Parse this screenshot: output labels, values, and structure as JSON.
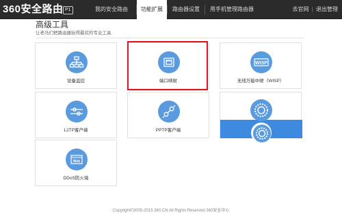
{
  "header": {
    "logo_text": "360安全路由",
    "model_badge": "P1",
    "tabs": [
      {
        "label": "我的安全路由"
      },
      {
        "label": "功能扩展"
      },
      {
        "label": "路由器设置"
      },
      {
        "label": "用手机管理路由器"
      }
    ],
    "right_links": [
      "去官网",
      "退出管理"
    ],
    "divider": "|"
  },
  "main": {
    "title": "高级工具",
    "subtitle": "让老马们把路由器玩得最欢的专业工具"
  },
  "tools": [
    {
      "label": "设备监控",
      "icon": "network-icon"
    },
    {
      "label": "端口映射",
      "icon": "port-icon"
    },
    {
      "label": "无线万能中继（WISP）",
      "icon": "wisp-icon"
    },
    {
      "label": "L2TP客户端",
      "icon": "l2tp-icon"
    },
    {
      "label": "PPTP客户端",
      "icon": "pptp-icon"
    },
    {
      "label": "",
      "icon": "gear-icon"
    },
    {
      "label": "DDoS防火墙",
      "icon": "firewall-icon"
    }
  ],
  "icon_texts": {
    "wisp": "WISP",
    "firewall": "Web"
  },
  "colors": {
    "accent": "#5a9be0",
    "topbar": "#2b2b2b",
    "highlight": "#e0141e",
    "active_card": "#3d8be0"
  },
  "footer": {
    "copyright": "Copyright©2005-2015 360.CN All Rights Reserved 360安全中心"
  }
}
